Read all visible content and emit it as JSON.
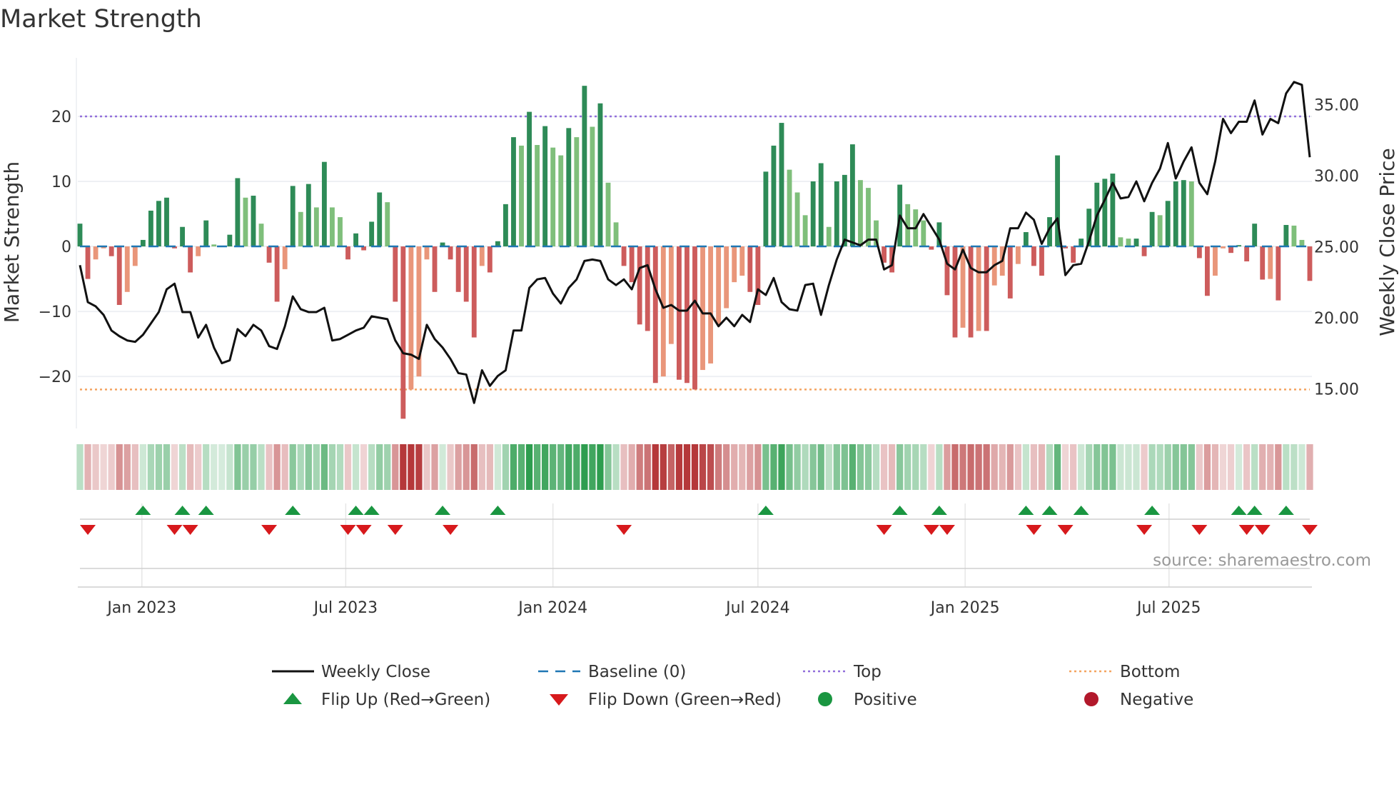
{
  "title": "Market Strength",
  "source": "source: sharemaestro.com",
  "colors": {
    "pos_strong": "#2e8b57",
    "pos_weak": "#7fbf7b",
    "neg_strong": "#cd5c5c",
    "neg_weak": "#e9967a",
    "close": "#111111",
    "baseline": "#1f77b4",
    "top": "#9370db",
    "bottom": "#f4a460",
    "flip_up": "#1a9641",
    "flip_down": "#d7191c",
    "positive": "#1a9641",
    "negative": "#b2182b"
  },
  "chart_data": {
    "type": "bar",
    "title": "Market Strength",
    "ylabel": "Market Strength",
    "y2label": "Weekly Close Price",
    "ylim": [
      -28,
      29
    ],
    "y2lim": [
      12.2,
      38.3
    ],
    "yticks": [
      {
        "v": 20,
        "label": "20"
      },
      {
        "v": 10,
        "label": "10"
      },
      {
        "v": 0,
        "label": "0"
      },
      {
        "v": -10,
        "label": "−10"
      },
      {
        "v": -20,
        "label": "−20"
      }
    ],
    "y2ticks": [
      {
        "v": 35,
        "label": "35.00"
      },
      {
        "v": 30,
        "label": "30.00"
      },
      {
        "v": 25,
        "label": "25.00"
      },
      {
        "v": 20,
        "label": "20.00"
      },
      {
        "v": 15,
        "label": "15.00"
      }
    ],
    "xticks": [
      {
        "date": "2023-01-01",
        "label": "Jan 2023"
      },
      {
        "date": "2023-07-01",
        "label": "Jul 2023"
      },
      {
        "date": "2024-01-01",
        "label": "Jan 2024"
      },
      {
        "date": "2024-07-01",
        "label": "Jul 2024"
      },
      {
        "date": "2025-01-01",
        "label": "Jan 2025"
      },
      {
        "date": "2025-07-01",
        "label": "Jul 2025"
      }
    ],
    "first_week": "2022-11-07",
    "top_level": 20,
    "bottom_level": -22,
    "baseline": 0,
    "strength": [
      3.5,
      -5,
      -2,
      -0.3,
      -1.5,
      -9,
      -7,
      -3,
      1,
      5.5,
      7,
      7.5,
      -0.3,
      3,
      -4,
      -1.5,
      4,
      0.3,
      0.1,
      1.8,
      10.5,
      7.5,
      7.8,
      3.5,
      -2.5,
      -8.5,
      -3.5,
      9.3,
      5.3,
      9.6,
      6,
      13,
      6,
      4.5,
      -2,
      2,
      -0.6,
      3.8,
      8.3,
      6.8,
      -8.5,
      -26.5,
      -22,
      -20,
      -2,
      -7,
      0.6,
      -2,
      -7,
      -8.5,
      -14,
      -3,
      -4,
      0.8,
      6.5,
      16.8,
      15.5,
      20.7,
      15.6,
      18.5,
      15.2,
      14,
      18.2,
      16.8,
      24.7,
      18.4,
      22,
      9.8,
      3.7,
      -3,
      -5.5,
      -12,
      -13,
      -21,
      -20,
      -15,
      -20.5,
      -21,
      -22,
      -19,
      -18,
      -12,
      -9.5,
      -5.5,
      -4.5,
      -7,
      -9,
      11.5,
      15.5,
      19,
      11.8,
      8.3,
      4.8,
      10,
      12.8,
      3,
      10,
      11,
      15.7,
      10.2,
      9,
      4,
      -2.5,
      -4,
      9.5,
      6.5,
      5.7,
      4,
      -0.5,
      3.7,
      -7.5,
      -14,
      -12.5,
      -14,
      -13,
      -13,
      -6,
      -4.5,
      -8,
      -2.7,
      2.2,
      -3,
      -4.5,
      4.5,
      14,
      -0.3,
      -2.5,
      1.2,
      5.8,
      9.8,
      10.4,
      11.2,
      1.4,
      1.2,
      1.2,
      -1.5,
      5.3,
      4.8,
      7,
      10,
      10.2,
      10,
      -1.8,
      -7.6,
      -4.5,
      -0.3,
      -1,
      0.2,
      -2.3,
      3.5,
      -5.1,
      -5,
      -8.3,
      3.3,
      3.2,
      1,
      -5.3
    ],
    "close": [
      23.7,
      21.1,
      20.8,
      20.2,
      19.1,
      18.7,
      18.4,
      18.3,
      18.8,
      19.6,
      20.4,
      22,
      22.4,
      20.4,
      20.4,
      18.6,
      19.5,
      17.9,
      16.8,
      17,
      19.2,
      18.7,
      19.5,
      19.1,
      18,
      17.8,
      19.4,
      21.5,
      20.6,
      20.4,
      20.4,
      20.7,
      18.4,
      18.5,
      18.8,
      19.1,
      19.3,
      20.1,
      20,
      19.9,
      18.4,
      17.5,
      17.4,
      17.1,
      19.5,
      18.5,
      17.9,
      17.1,
      16.1,
      16,
      14,
      16.3,
      15.2,
      15.9,
      16.3,
      19.1,
      19.1,
      22.1,
      22.7,
      22.8,
      21.7,
      21,
      22.1,
      22.7,
      24,
      24.1,
      24,
      22.7,
      22.3,
      22.7,
      22,
      23.5,
      23.7,
      22,
      20.7,
      20.9,
      20.5,
      20.5,
      21.2,
      20.3,
      20.3,
      19.4,
      20,
      19.4,
      20.2,
      19.7,
      22,
      21.6,
      22.8,
      21.1,
      20.6,
      20.5,
      22.3,
      22.4,
      20.2,
      22.3,
      24.1,
      25.5,
      25.3,
      25.1,
      25.5,
      25.5,
      23.4,
      23.7,
      27.2,
      26.3,
      26.3,
      27.3,
      26.4,
      25.5,
      23.8,
      23.4,
      24.8,
      23.5,
      23.2,
      23.2,
      23.7,
      24,
      26.3,
      26.3,
      27.4,
      26.9,
      25.2,
      26.3,
      27,
      23,
      23.7,
      23.8,
      25.4,
      27.2,
      28.3,
      29.5,
      28.4,
      28.5,
      29.6,
      28.2,
      29.5,
      30.5,
      32.3,
      29.8,
      31,
      32,
      29.5,
      28.7,
      31,
      34,
      33,
      33.8,
      33.8,
      35.3,
      32.9,
      34,
      33.7,
      35.8,
      36.6,
      36.4,
      31.3
    ],
    "flip_up_weeks": [
      8,
      13,
      16,
      27,
      35,
      37,
      46,
      53,
      87,
      104,
      109,
      120,
      123,
      127,
      136,
      147,
      149,
      153
    ],
    "flip_down_weeks": [
      1,
      12,
      14,
      24,
      34,
      36,
      40,
      47,
      69,
      102,
      108,
      110,
      121,
      125,
      135,
      142,
      148,
      150,
      156
    ]
  },
  "legend": [
    {
      "label": "Weekly Close",
      "kind": "line"
    },
    {
      "label": "Baseline (0)",
      "kind": "dash"
    },
    {
      "label": "Top",
      "kind": "dotted-top"
    },
    {
      "label": "Bottom",
      "kind": "dotted-bottom"
    },
    {
      "label": "Flip Up (Red→Green)",
      "kind": "tri-up"
    },
    {
      "label": "Flip Down (Green→Red)",
      "kind": "tri-down"
    },
    {
      "label": "Positive",
      "kind": "dot-pos"
    },
    {
      "label": "Negative",
      "kind": "dot-neg"
    }
  ]
}
